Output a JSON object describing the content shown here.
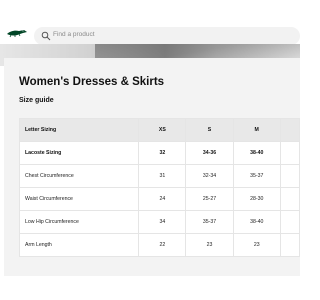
{
  "header": {
    "logo_icon": "crocodile-logo-icon",
    "brand_color": "#004526",
    "search": {
      "placeholder": "Find a product",
      "icon": "search-icon"
    }
  },
  "page": {
    "title": "Women's Dresses & Skirts",
    "subtitle": "Size guide"
  },
  "size_table": {
    "header_label": "Letter Sizing",
    "letter_sizes": [
      "XS",
      "S",
      "M"
    ],
    "lacoste_label": "Lacoste Sizing",
    "lacoste_sizes": [
      "32",
      "34-36",
      "38-40"
    ],
    "rows": [
      {
        "label": "Chest Circumference",
        "values": [
          "31",
          "32-34",
          "35-37"
        ]
      },
      {
        "label": "Waist Circumference",
        "values": [
          "24",
          "25-27",
          "28-30"
        ]
      },
      {
        "label": "Low Hip Circumference",
        "values": [
          "34",
          "35-37",
          "38-40"
        ]
      },
      {
        "label": "Arm Length",
        "values": [
          "22",
          "23",
          "23"
        ]
      }
    ]
  }
}
